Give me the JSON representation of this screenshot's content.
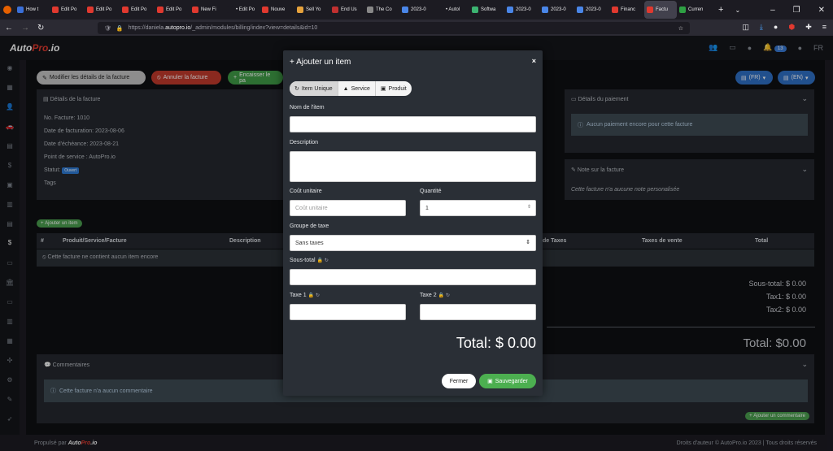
{
  "browser": {
    "tabs": [
      {
        "label": "How t",
        "color": "#3a6fd8"
      },
      {
        "label": "Edit Po",
        "color": "#e0392f"
      },
      {
        "label": "Edit Po",
        "color": "#e0392f"
      },
      {
        "label": "Edit Po",
        "color": "#e0392f"
      },
      {
        "label": "Edit Po",
        "color": "#e0392f"
      },
      {
        "label": "New Fi",
        "color": "#e0392f"
      },
      {
        "label": "• Edit Po",
        "color": "#1c1b22"
      },
      {
        "label": "Nouve",
        "color": "#e0392f"
      },
      {
        "label": "Sell Yo",
        "color": "#e6a23c"
      },
      {
        "label": "End Us",
        "color": "#c03030"
      },
      {
        "label": "The Co",
        "color": "#888888"
      },
      {
        "label": "2023-0",
        "color": "#4a86e8"
      },
      {
        "label": "• Autol",
        "color": "#1c1b22"
      },
      {
        "label": "Softwa",
        "color": "#3cb371"
      },
      {
        "label": "2023-0",
        "color": "#4a86e8"
      },
      {
        "label": "2023-0",
        "color": "#4a86e8"
      },
      {
        "label": "2023-0",
        "color": "#4a86e8"
      },
      {
        "label": "Financ",
        "color": "#e0392f"
      },
      {
        "label": "Factu",
        "color": "#e0392f"
      },
      {
        "label": "Curren",
        "color": "#2ea043"
      }
    ],
    "active_tab_index": 18,
    "url_prefix": "https://daniela.",
    "url_host": "autopro.io",
    "url_rest": "/_admin/modules/billing/index?view=details&id=10"
  },
  "header": {
    "logo_main": "Auto",
    "logo_accent": "Pro",
    "logo_suffix": ".io",
    "notif_count": "13",
    "lang": "FR"
  },
  "toolbar": {
    "edit_label": "Modifier les détails de la facture",
    "cancel_label": "Annuler la facture",
    "collect_label": "Encaisser le pa",
    "fr_label": "(FR)",
    "en_label": "(EN)"
  },
  "invoice": {
    "section_title": "Détails de la facture",
    "number": "No. Facture: 1010",
    "billing_date": "Date de facturation: 2023-08-06",
    "due_date": "Date d'échéance: 2023-08-21",
    "service_point": "Point de service : AutoPro.io",
    "status_label": "Statut:",
    "status_value": "Ouvert",
    "tags_label": "Tags"
  },
  "payment": {
    "section_title": "Détails du paiement",
    "empty": "Aucun paiement encore pour cette facture"
  },
  "note": {
    "section_title": "Note sur la facture",
    "empty": "Cette facture n'a aucune note personalisée"
  },
  "items": {
    "add_label": "Ajouter un item",
    "headers": {
      "num": "#",
      "product": "Produit/Service/Facture",
      "desc": "Description",
      "taxes": "de Taxes",
      "sale_taxes": "Taxes de vente",
      "total": "Total"
    },
    "empty": "Cette facture ne contient aucun item encore"
  },
  "totals": {
    "subtotal": "Sous-total: $ 0.00",
    "tax1": "Tax1: $ 0.00",
    "tax2": "Tax2: $ 0.00",
    "total": "Total: $0.00"
  },
  "comments": {
    "section_title": "Commentaires",
    "empty": "Cette facture n'a aucun commentaire",
    "add_label": "Ajouter un commentaire"
  },
  "footer": {
    "left": "Propulsé par",
    "right": "Droits d'auteur © AutoPro.io 2023 | Tous droits réservés"
  },
  "modal": {
    "title": "Ajouter un item",
    "close": "×",
    "segments": [
      {
        "label": "Item Unique",
        "icon": "refresh-icon"
      },
      {
        "label": "Service",
        "icon": "car-icon"
      },
      {
        "label": "Produit",
        "icon": "box-icon"
      }
    ],
    "name_label": "Nom de l'item",
    "name_value": "",
    "desc_label": "Description",
    "desc_value": "",
    "unit_cost_label": "Coût unitaire",
    "unit_cost_placeholder": "Coût unitaire",
    "quantity_label": "Quantité",
    "quantity_value": "1",
    "tax_group_label": "Groupe de taxe",
    "tax_group_value": "Sans taxes",
    "subtotal_label": "Sous-total",
    "tax1_label": "Taxe 1",
    "tax2_label": "Taxe 2",
    "total": "Total: $ 0.00",
    "close_button": "Fermer",
    "save_button": "Sauvegarder"
  }
}
